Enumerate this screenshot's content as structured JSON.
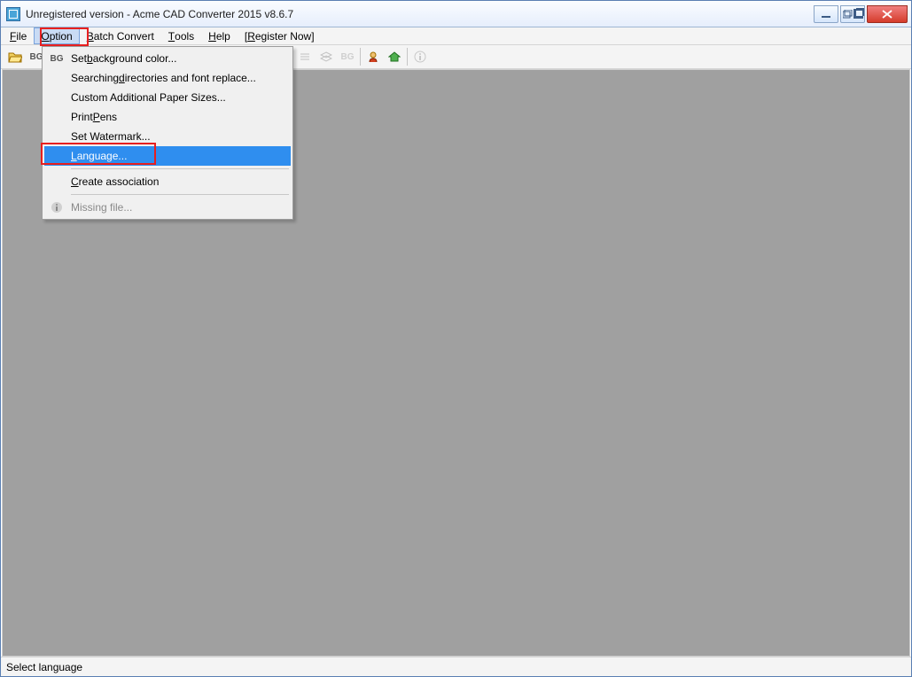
{
  "window": {
    "title": "Unregistered version - Acme CAD Converter 2015 v8.6.7"
  },
  "menubar": {
    "items": [
      {
        "label_pre": "",
        "label_ul": "F",
        "label_post": "ile"
      },
      {
        "label_pre": "",
        "label_ul": "O",
        "label_post": "ption"
      },
      {
        "label_pre": "",
        "label_ul": "B",
        "label_post": "atch Convert"
      },
      {
        "label_pre": "",
        "label_ul": "T",
        "label_post": "ools"
      },
      {
        "label_pre": "",
        "label_ul": "H",
        "label_post": "elp"
      },
      {
        "label_pre": "[",
        "label_ul": "R",
        "label_post": "egister Now]"
      }
    ],
    "open_index": 1
  },
  "toolbar": {
    "icons": [
      "open-icon",
      "bg-text-icon",
      null,
      "save-icon",
      "print-icon",
      "tree-icon",
      "zoom-window-icon",
      "zoom-extents-icon",
      "zoom-in-icon",
      "zoom-out-icon",
      "width-icon",
      "plot-icon",
      "hand-icon",
      "view-icon",
      "layers-icon",
      "bg2-icon",
      null,
      "user-icon",
      "home-icon",
      "info-icon"
    ]
  },
  "dropdown": {
    "items": [
      {
        "type": "item",
        "icon": "BG",
        "pre": "Set ",
        "ul": "b",
        "post": "ackground color..."
      },
      {
        "type": "item",
        "pre": "Searching ",
        "ul": "d",
        "post": "irectories and font replace..."
      },
      {
        "type": "item",
        "pre": "Custom Additional Paper Sizes...",
        "ul": "",
        "post": ""
      },
      {
        "type": "item",
        "pre": "Print ",
        "ul": "P",
        "post": "ens"
      },
      {
        "type": "item",
        "pre": "Set Watermark...",
        "ul": "",
        "post": ""
      },
      {
        "type": "item",
        "selected": true,
        "ul": "L",
        "pre": "",
        "post": "anguage..."
      },
      {
        "type": "sep"
      },
      {
        "type": "item",
        "ul": "C",
        "pre": "",
        "post": "reate association"
      },
      {
        "type": "sep"
      },
      {
        "type": "item",
        "disabled": true,
        "icon": "ℹ",
        "pre": "Missing file...",
        "ul": "",
        "post": ""
      }
    ]
  },
  "statusbar": {
    "text": "Select language"
  }
}
